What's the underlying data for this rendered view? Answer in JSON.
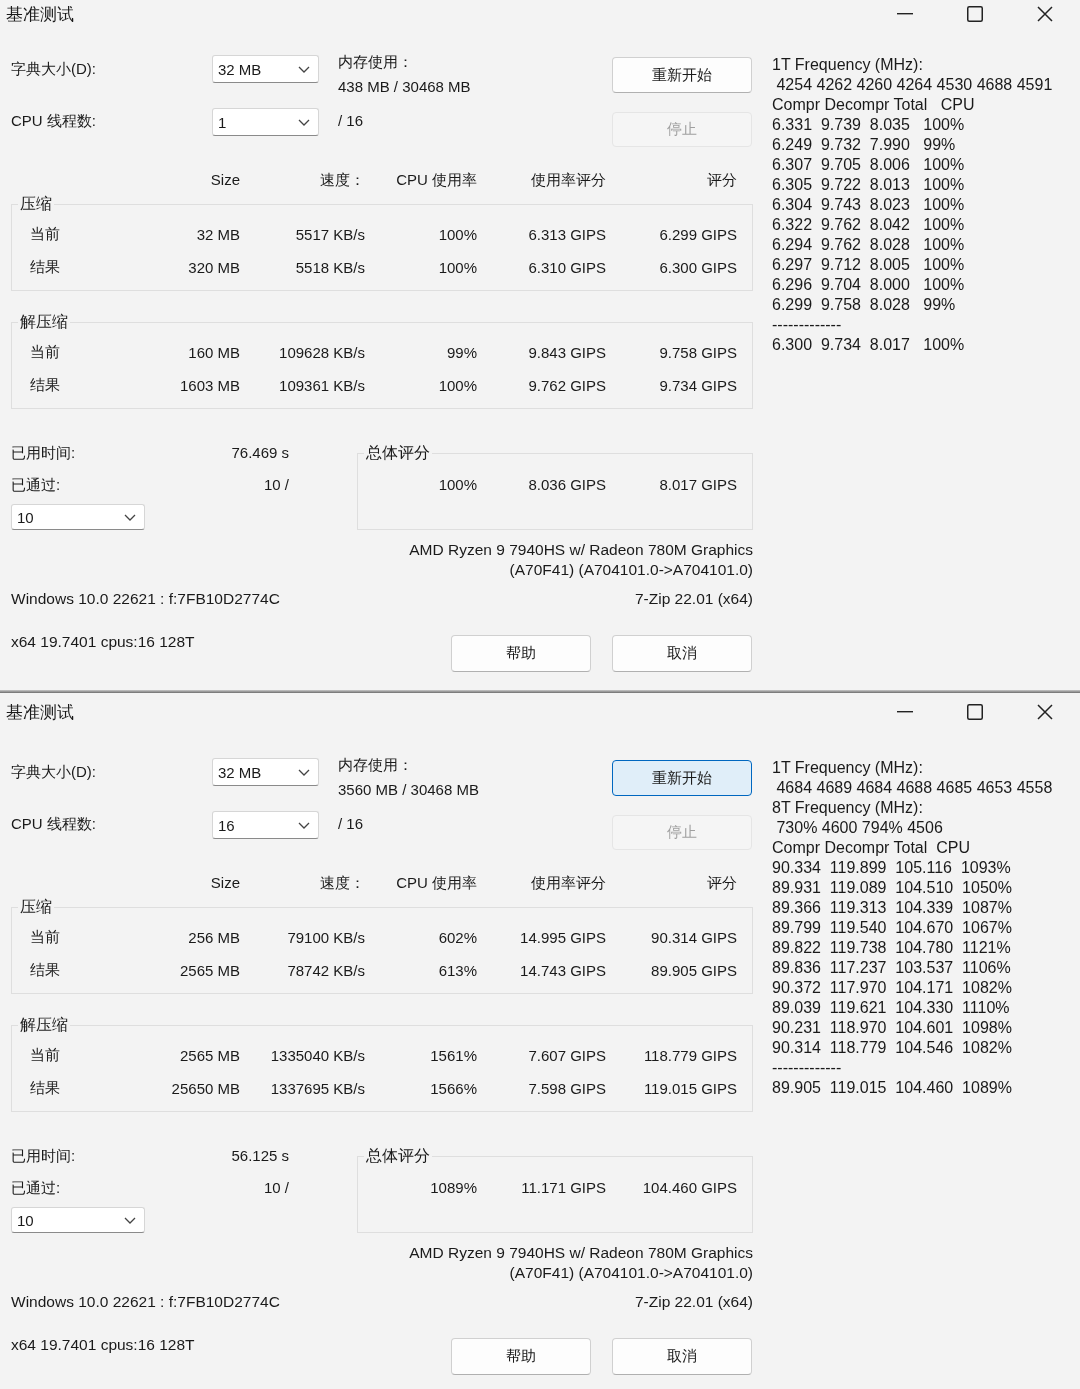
{
  "windows": [
    {
      "title": "基准测试",
      "dictionary": {
        "label": "字典大小(D):",
        "value": "32 MB"
      },
      "memory": {
        "label": "内存使用：",
        "value": "438 MB / 30468 MB"
      },
      "threads": {
        "label": "CPU 线程数:",
        "value": "1",
        "total": "/ 16"
      },
      "restart_button": {
        "label": "重新开始",
        "focused": false
      },
      "stop_button": {
        "label": "停止",
        "disabled": true
      },
      "columns": [
        "Size",
        "速度：",
        "CPU 使用率",
        "使用率评分",
        "评分"
      ],
      "sections": [
        {
          "title": "压缩",
          "rows": [
            {
              "label": "当前",
              "cells": [
                "32 MB",
                "5517 KB/s",
                "100%",
                "6.313 GIPS",
                "6.299 GIPS"
              ]
            },
            {
              "label": "结果",
              "cells": [
                "320 MB",
                "5518 KB/s",
                "100%",
                "6.310 GIPS",
                "6.300 GIPS"
              ]
            }
          ]
        },
        {
          "title": "解压缩",
          "rows": [
            {
              "label": "当前",
              "cells": [
                "160 MB",
                "109628 KB/s",
                "99%",
                "9.843 GIPS",
                "9.758 GIPS"
              ]
            },
            {
              "label": "结果",
              "cells": [
                "1603 MB",
                "109361 KB/s",
                "100%",
                "9.762 GIPS",
                "9.734 GIPS"
              ]
            }
          ]
        }
      ],
      "elapsed": {
        "label": "已用时间:",
        "value": "76.469 s"
      },
      "passed": {
        "label": "已通过:",
        "value": "10 /"
      },
      "passes_select": "10",
      "total": {
        "title": "总体评分",
        "cells": [
          "100%",
          "8.036 GIPS",
          "8.017 GIPS"
        ]
      },
      "cpu_lines": [
        "AMD Ryzen 9 7940HS w/ Radeon 780M Graphics",
        "(A70F41) (A704101.0->A704101.0)"
      ],
      "system": "Windows 10.0 22621 : f:7FB10D2774C",
      "version": "7-Zip 22.01 (x64)",
      "build": "x64 19.7401 cpus:16 128T",
      "help_button": "帮助",
      "cancel_button": "取消",
      "log": [
        "1T Frequency (MHz):",
        " 4254 4262 4260 4264 4530 4688 4591",
        "Compr Decompr Total   CPU",
        "6.331  9.739  8.035   100%",
        "6.249  9.732  7.990   99%",
        "6.307  9.705  8.006   100%",
        "6.305  9.722  8.013   100%",
        "6.304  9.743  8.023   100%",
        "6.322  9.762  8.042   100%",
        "6.294  9.762  8.028   100%",
        "6.297  9.712  8.005   100%",
        "6.296  9.704  8.000   100%",
        "6.299  9.758  8.028   99%",
        "-------------",
        "6.300  9.734  8.017   100%"
      ]
    },
    {
      "title": "基准测试",
      "dictionary": {
        "label": "字典大小(D):",
        "value": "32 MB"
      },
      "memory": {
        "label": "内存使用：",
        "value": "3560 MB / 30468 MB"
      },
      "threads": {
        "label": "CPU 线程数:",
        "value": "16",
        "total": "/ 16"
      },
      "restart_button": {
        "label": "重新开始",
        "focused": true
      },
      "stop_button": {
        "label": "停止",
        "disabled": true
      },
      "columns": [
        "Size",
        "速度：",
        "CPU 使用率",
        "使用率评分",
        "评分"
      ],
      "sections": [
        {
          "title": "压缩",
          "rows": [
            {
              "label": "当前",
              "cells": [
                "256 MB",
                "79100 KB/s",
                "602%",
                "14.995 GIPS",
                "90.314 GIPS"
              ]
            },
            {
              "label": "结果",
              "cells": [
                "2565 MB",
                "78742 KB/s",
                "613%",
                "14.743 GIPS",
                "89.905 GIPS"
              ]
            }
          ]
        },
        {
          "title": "解压缩",
          "rows": [
            {
              "label": "当前",
              "cells": [
                "2565 MB",
                "1335040 KB/s",
                "1561%",
                "7.607 GIPS",
                "118.779 GIPS"
              ]
            },
            {
              "label": "结果",
              "cells": [
                "25650 MB",
                "1337695 KB/s",
                "1566%",
                "7.598 GIPS",
                "119.015 GIPS"
              ]
            }
          ]
        }
      ],
      "elapsed": {
        "label": "已用时间:",
        "value": "56.125 s"
      },
      "passed": {
        "label": "已通过:",
        "value": "10 /"
      },
      "passes_select": "10",
      "total": {
        "title": "总体评分",
        "cells": [
          "1089%",
          "11.171 GIPS",
          "104.460 GIPS"
        ]
      },
      "cpu_lines": [
        "AMD Ryzen 9 7940HS w/ Radeon 780M Graphics",
        "(A70F41) (A704101.0->A704101.0)"
      ],
      "system": "Windows 10.0 22621 : f:7FB10D2774C",
      "version": "7-Zip 22.01 (x64)",
      "build": "x64 19.7401 cpus:16 128T",
      "help_button": "帮助",
      "cancel_button": "取消",
      "log": [
        "1T Frequency (MHz):",
        " 4684 4689 4684 4688 4685 4653 4558",
        "8T Frequency (MHz):",
        " 730% 4600 794% 4506",
        "Compr Decompr Total  CPU",
        "90.334  119.899  105.116  1093%",
        "89.931  119.089  104.510  1050%",
        "89.366  119.313  104.339  1087%",
        "89.799  119.540  104.670  1067%",
        "89.822  119.738  104.780  1121%",
        "89.836  117.237  103.537  1106%",
        "90.372  117.970  104.171  1082%",
        "89.039  119.621  104.330  1110%",
        "90.231  118.970  104.601  1098%",
        "90.314  118.779  104.546  1082%",
        "-------------",
        "89.905  119.015  104.460  1089%"
      ]
    }
  ]
}
